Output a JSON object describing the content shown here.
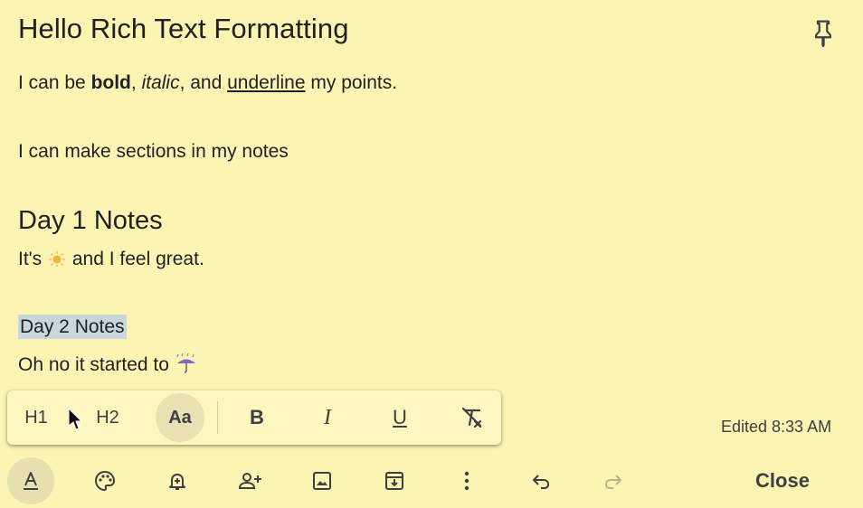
{
  "note": {
    "title": "Hello Rich Text Formatting",
    "line1": {
      "pre": "I can be ",
      "bold": "bold",
      "sep1": ", ",
      "italic": "italic",
      "sep2": ", and ",
      "underline": "underline",
      "post": " my points."
    },
    "line2": "I can make sections in my notes",
    "heading1": "Day 1 Notes",
    "day1_text_pre": "It's ",
    "day1_text_post": " and I feel great.",
    "heading2": "Day 2 Notes",
    "day2_text": "Oh no it started to "
  },
  "format_toolbar": {
    "h1": "H1",
    "h2": "H2",
    "normal_text": "Aa",
    "bold": "B",
    "italic": "I",
    "underline": "U"
  },
  "status": {
    "edited": "Edited 8:33 AM"
  },
  "bottom_toolbar": {
    "close": "Close"
  },
  "icons": {
    "pin": "pin-icon",
    "sun": "sun-emoji-icon",
    "umbrella": "umbrella-rain-emoji-icon",
    "clear_format": "clear-formatting-icon",
    "text_format": "text-format-icon",
    "palette": "palette-icon",
    "reminder": "bell-plus-icon",
    "collaborator": "person-add-icon",
    "image": "image-icon",
    "archive": "archive-icon",
    "more": "more-vert-icon",
    "undo": "undo-icon",
    "redo": "redo-icon",
    "cursor": "mouse-cursor-icon"
  }
}
